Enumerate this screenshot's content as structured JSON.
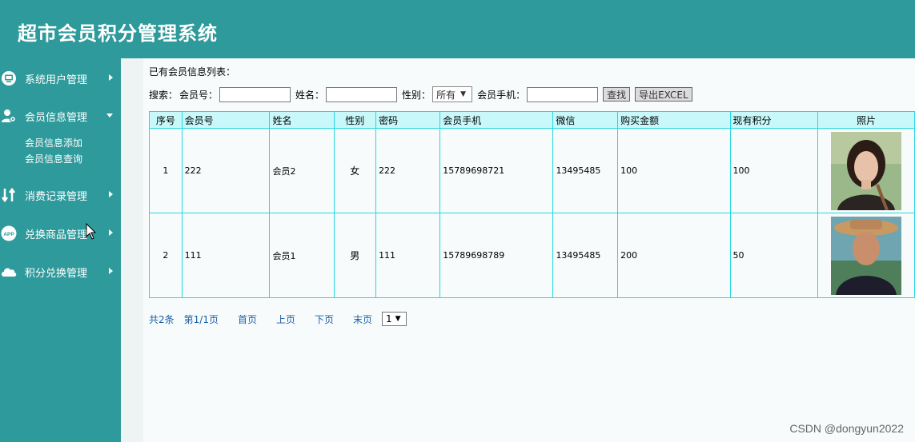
{
  "app": {
    "title": "超市会员积分管理系统"
  },
  "sidebar": {
    "items": [
      {
        "label": "系统用户管理",
        "icon": "monitor-icon",
        "expanded": false
      },
      {
        "label": "会员信息管理",
        "icon": "user-gear-icon",
        "expanded": true
      },
      {
        "label": "消费记录管理",
        "icon": "transfer-arrows-icon",
        "expanded": false
      },
      {
        "label": "兑换商品管理",
        "icon": "app-badge-icon",
        "icon_text": "APP",
        "expanded": false
      },
      {
        "label": "积分兑换管理",
        "icon": "cloud-icon",
        "expanded": false
      }
    ],
    "subitems": [
      {
        "label": "会员信息添加"
      },
      {
        "label": "会员信息查询"
      }
    ]
  },
  "main": {
    "list_title": "已有会员信息列表：",
    "search": {
      "prefix": "搜索：",
      "member_no_label": "会员号：",
      "member_no_value": "",
      "name_label": "姓名：",
      "name_value": "",
      "gender_label": "性别：",
      "gender_selected": "所有",
      "phone_label": "会员手机：",
      "phone_value": "",
      "search_button": "查找",
      "export_button": "导出EXCEL"
    },
    "table": {
      "headers": [
        "序号",
        "会员号",
        "姓名",
        "性别",
        "密码",
        "会员手机",
        "微信",
        "购买金额",
        "现有积分",
        "照片"
      ],
      "rows": [
        {
          "no": "1",
          "member_no": "222",
          "name": "会员2",
          "gender": "女",
          "password": "222",
          "phone": "15789698721",
          "wechat": "13495485",
          "amount": "100",
          "points": "100"
        },
        {
          "no": "2",
          "member_no": "111",
          "name": "会员1",
          "gender": "男",
          "password": "111",
          "phone": "15789698789",
          "wechat": "13495485",
          "amount": "200",
          "points": "50"
        }
      ]
    },
    "pager": {
      "total": "共2条",
      "page_info": "第1/1页",
      "first": "首页",
      "prev": "上页",
      "next": "下页",
      "last": "末页",
      "page_selected": "1"
    }
  },
  "watermark": "CSDN @dongyun2022",
  "colors": {
    "header_bg": "#2f9a9b",
    "table_border": "#27d7e0",
    "table_header_bg": "#c8f8fa",
    "link": "#1b5fa8"
  }
}
